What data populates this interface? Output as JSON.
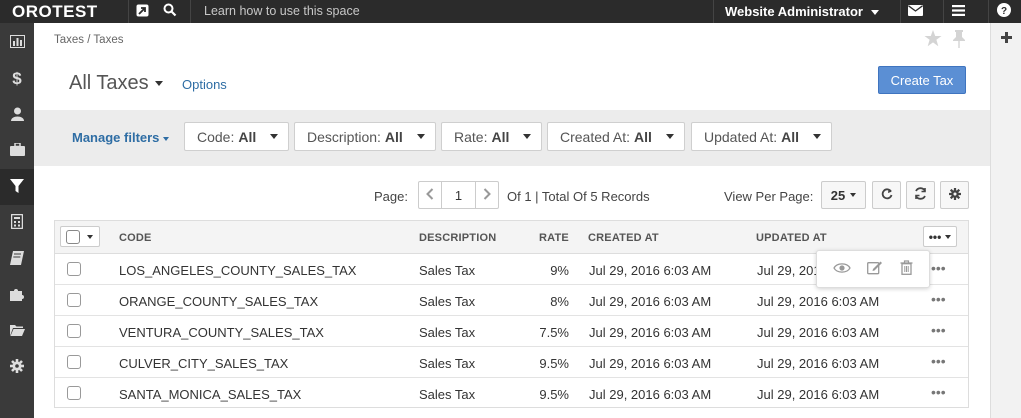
{
  "topbar": {
    "logo": "OROTEST",
    "search_hint": "Learn how to use this space",
    "user": "Website Administrator"
  },
  "breadcrumb": "Taxes / Taxes",
  "page": {
    "title": "All Taxes",
    "options_label": "Options",
    "create_label": "Create Tax"
  },
  "filters": {
    "manage_label": "Manage filters",
    "items": [
      {
        "label": "Code:",
        "value": "All"
      },
      {
        "label": "Description:",
        "value": "All"
      },
      {
        "label": "Rate:",
        "value": "All"
      },
      {
        "label": "Created At:",
        "value": "All"
      },
      {
        "label": "Updated At:",
        "value": "All"
      }
    ]
  },
  "pager": {
    "page_label": "Page:",
    "current_page": "1",
    "summary": "Of 1 | Total Of 5 Records",
    "view_per_page_label": "View Per Page:",
    "per_page": "25"
  },
  "grid": {
    "columns": {
      "code": "CODE",
      "description": "DESCRIPTION",
      "rate": "RATE",
      "created": "CREATED AT",
      "updated": "UPDATED AT"
    },
    "rows": [
      {
        "code": "LOS_ANGELES_COUNTY_SALES_TAX",
        "description": "Sales Tax",
        "rate": "9%",
        "created": "Jul 29, 2016 6:03 AM",
        "updated": "Jul 29, 2016 6:03 AM"
      },
      {
        "code": "ORANGE_COUNTY_SALES_TAX",
        "description": "Sales Tax",
        "rate": "8%",
        "created": "Jul 29, 2016 6:03 AM",
        "updated": "Jul 29, 2016 6:03 AM"
      },
      {
        "code": "VENTURA_COUNTY_SALES_TAX",
        "description": "Sales Tax",
        "rate": "7.5%",
        "created": "Jul 29, 2016 6:03 AM",
        "updated": "Jul 29, 2016 6:03 AM"
      },
      {
        "code": "CULVER_CITY_SALES_TAX",
        "description": "Sales Tax",
        "rate": "9.5%",
        "created": "Jul 29, 2016 6:03 AM",
        "updated": "Jul 29, 2016 6:03 AM"
      },
      {
        "code": "SANTA_MONICA_SALES_TAX",
        "description": "Sales Tax",
        "rate": "9.5%",
        "created": "Jul 29, 2016 6:03 AM",
        "updated": "Jul 29, 2016 6:03 AM"
      }
    ]
  },
  "icons": {
    "topbar": [
      "shortcut-icon",
      "search-icon",
      "mail-icon",
      "menu-icon",
      "help-icon"
    ],
    "sidebar": [
      "dashboard-icon",
      "dollar-icon",
      "user-icon",
      "briefcase-icon",
      "filter-icon",
      "calculator-icon",
      "book-icon",
      "puzzle-icon",
      "folder-icon",
      "gear-icon"
    ],
    "row_actions": [
      "view-icon",
      "edit-icon",
      "delete-icon"
    ]
  },
  "colors": {
    "topbar": "#2b2b2b",
    "sidebar": "#3a3a3a",
    "link": "#2e6da4",
    "primary_button": "#5b8fd4",
    "filter_bar": "#ececec"
  }
}
